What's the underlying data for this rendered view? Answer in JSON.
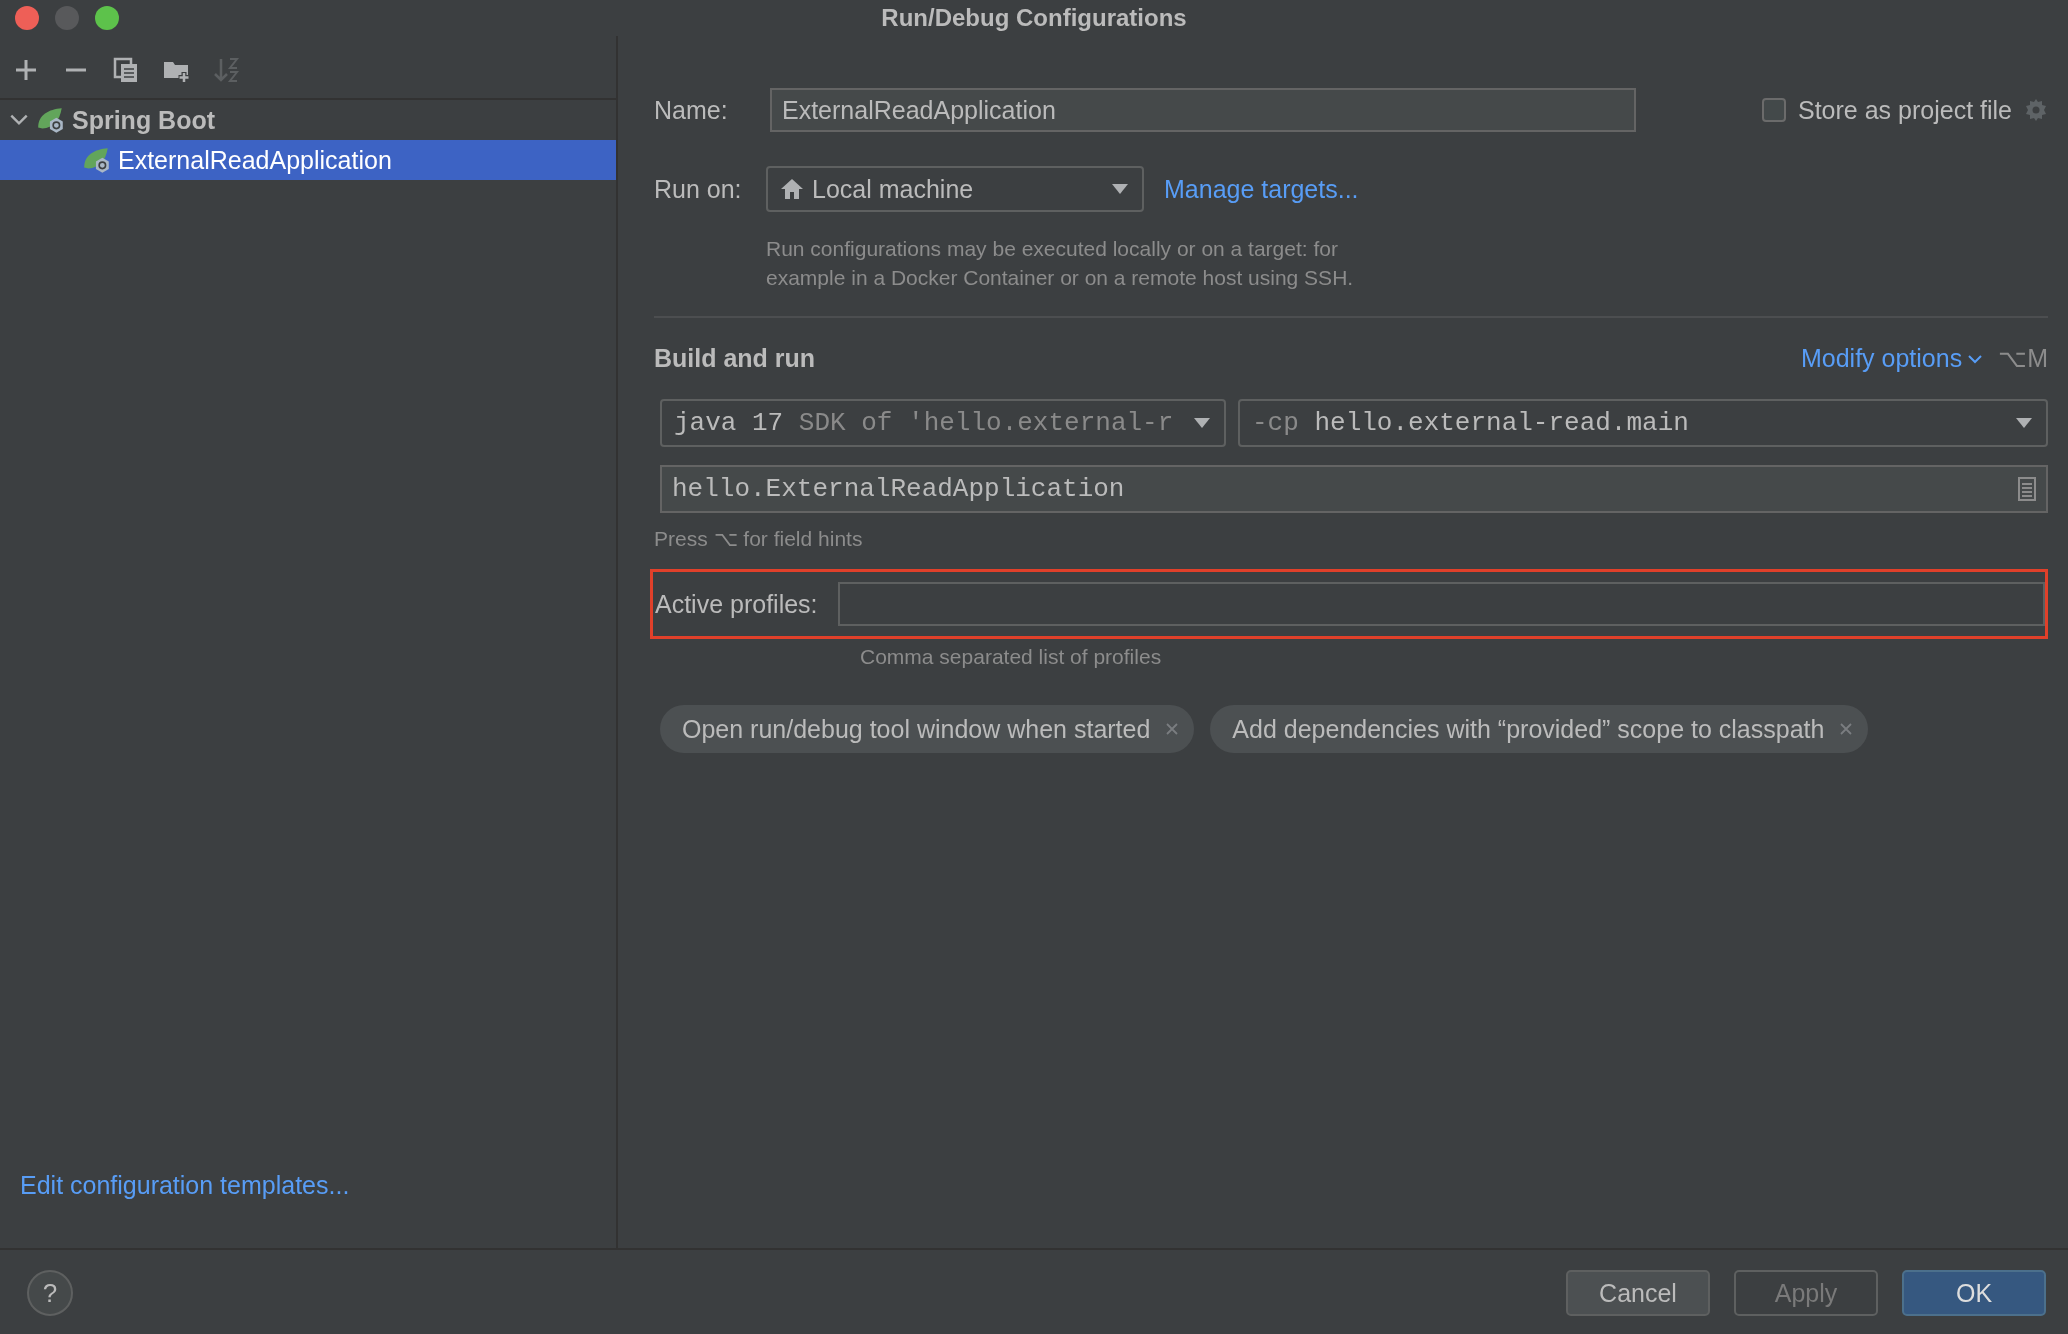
{
  "window": {
    "title": "Run/Debug Configurations"
  },
  "toolbar": [
    {
      "kind": "add",
      "disabled": false
    },
    {
      "kind": "remove",
      "disabled": false
    },
    {
      "kind": "copy",
      "disabled": false
    },
    {
      "kind": "folder",
      "disabled": false
    },
    {
      "kind": "sort",
      "disabled": true
    }
  ],
  "tree": [
    {
      "label": "Spring Boot",
      "expanded": true,
      "selected": false,
      "children": [
        {
          "label": "ExternalReadApplication",
          "selected": true
        }
      ]
    }
  ],
  "edit_templates_link": "Edit configuration templates...",
  "name": {
    "label": "Name:",
    "value": "ExternalReadApplication"
  },
  "store_as_project_file": {
    "label": "Store as project file",
    "checked": false
  },
  "run_on": {
    "label": "Run on:",
    "value": "Local machine",
    "link": "Manage targets...",
    "hint": "Run configurations may be executed locally or on a target: for example in a Docker Container or on a remote host using SSH."
  },
  "build_and_run": {
    "title": "Build and run",
    "modify_options": "Modify options",
    "shortcut": "⌥M",
    "sdk": {
      "value": "java 17",
      "detail": "SDK of 'hello.external-r"
    },
    "classpath": {
      "prefix": "-cp",
      "value": "hello.external-read.main"
    },
    "main_class": "hello.ExternalReadApplication",
    "hint": "Press ⌥ for field hints"
  },
  "active_profiles": {
    "label": "Active profiles:",
    "hint": "Comma separated list of profiles",
    "highlighted": true
  },
  "options": [
    {
      "label": "Open run/debug tool window when started"
    },
    {
      "label": "Add dependencies with “provided” scope to classpath"
    }
  ],
  "help": "?",
  "buttons": [
    {
      "label": "Cancel",
      "kind": "default"
    },
    {
      "label": "Apply",
      "kind": "disabled"
    },
    {
      "label": "OK",
      "kind": "primary"
    }
  ]
}
